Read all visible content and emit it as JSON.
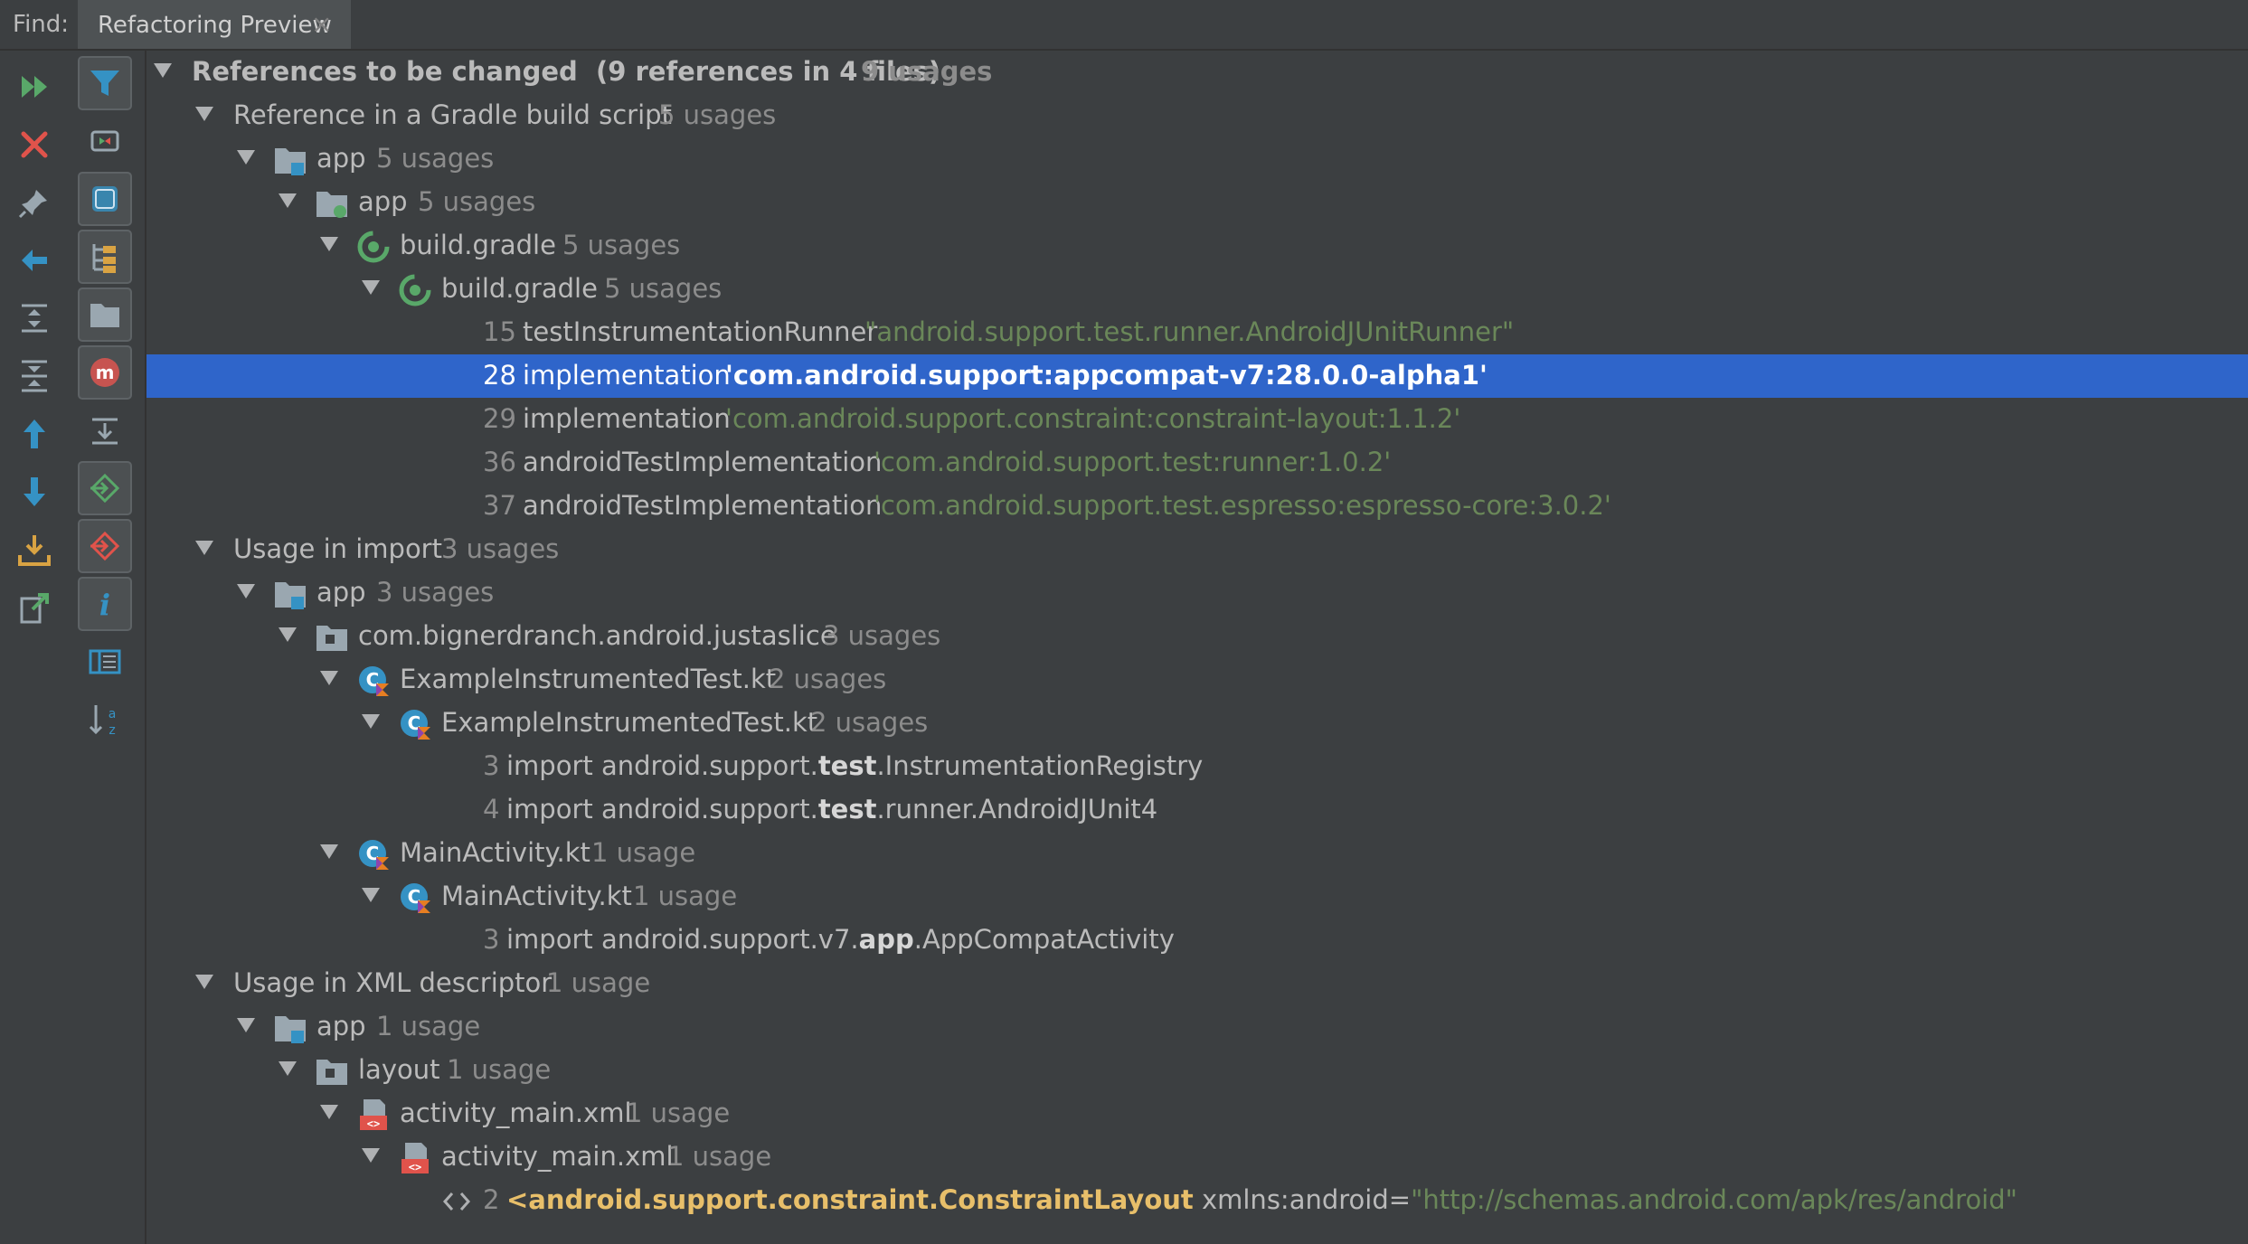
{
  "topbar": {
    "find_label": "Find:",
    "tab_label": "Refactoring Preview",
    "tab_close": "×"
  },
  "toolbar_left": [
    "rerun-icon",
    "close-icon",
    "pin-icon",
    "previous-occurrence-icon",
    "expand-all-icon",
    "collapse-all-icon",
    "up-icon",
    "down-icon",
    "export-icon",
    "import-icon"
  ],
  "toolbar_right": [
    "filter-icon",
    "group-by-type-icon",
    "group-by-module-icon",
    "group-by-package-icon",
    "group-by-directory-icon",
    "group-by-method-icon",
    "merge-icon",
    "include-icon",
    "exclude-icon",
    "info-icon",
    "preview-icon",
    "sort-icon"
  ],
  "colors": {
    "background": "#3c3f41",
    "selection": "#2f65ca",
    "string": "#6a8759",
    "xml_tag": "#e8bf6a",
    "count": "#8c8c8c"
  },
  "tree": {
    "root": {
      "label": "References to be changed  (9 references in 4 files)",
      "count": "9 usages"
    },
    "gradle": {
      "label": "Reference in a Gradle build script",
      "count": "5 usages",
      "module": {
        "label": "app",
        "count": "5 usages"
      },
      "folder": {
        "label": "app",
        "count": "5 usages"
      },
      "file1": {
        "label": "build.gradle",
        "count": "5 usages"
      },
      "file2": {
        "label": "build.gradle",
        "count": "5 usages"
      },
      "lines": [
        {
          "num": "15",
          "code": "testInstrumentationRunner",
          "str": "\"android.support.test.runner.AndroidJUnitRunner\""
        },
        {
          "num": "28",
          "code": "implementation",
          "str": "'com.android.support:appcompat-v7:28.0.0-alpha1'"
        },
        {
          "num": "29",
          "code": "implementation",
          "str": "'com.android.support.constraint:constraint-layout:1.1.2'"
        },
        {
          "num": "36",
          "code": "androidTestImplementation",
          "str": "'com.android.support.test:runner:1.0.2'"
        },
        {
          "num": "37",
          "code": "androidTestImplementation",
          "str": "'com.android.support.test.espresso:espresso-core:3.0.2'"
        }
      ]
    },
    "imports": {
      "label": "Usage in import",
      "count": "3 usages",
      "module": {
        "label": "app",
        "count": "3 usages"
      },
      "package": {
        "label": "com.bignerdranch.android.justaslice",
        "count": "3 usages"
      },
      "test_file1": {
        "label": "ExampleInstrumentedTest.kt",
        "count": "2 usages"
      },
      "test_file2": {
        "label": "ExampleInstrumentedTest.kt",
        "count": "2 usages"
      },
      "test_lines": [
        {
          "num": "3",
          "pre": "import android.support.",
          "hl": "test",
          "post": ".InstrumentationRegistry"
        },
        {
          "num": "4",
          "pre": "import android.support.",
          "hl": "test",
          "post": ".runner.AndroidJUnit4"
        }
      ],
      "main_file1": {
        "label": "MainActivity.kt",
        "count": "1 usage"
      },
      "main_file2": {
        "label": "MainActivity.kt",
        "count": "1 usage"
      },
      "main_line": {
        "num": "3",
        "pre": "import android.support.v7.",
        "hl": "app",
        "post": ".AppCompatActivity"
      }
    },
    "xml": {
      "label": "Usage in XML descriptor",
      "count": "1 usage",
      "module": {
        "label": "app",
        "count": "1 usage"
      },
      "folder": {
        "label": "layout",
        "count": "1 usage"
      },
      "file1": {
        "label": "activity_main.xml",
        "count": "1 usage"
      },
      "file2": {
        "label": "activity_main.xml",
        "count": "1 usage"
      },
      "line": {
        "num": "2",
        "tag": "<android.support.constraint.ConstraintLayout",
        "attr": " xmlns:android=",
        "str": "\"http://schemas.android.com/apk/res/android\""
      }
    }
  }
}
